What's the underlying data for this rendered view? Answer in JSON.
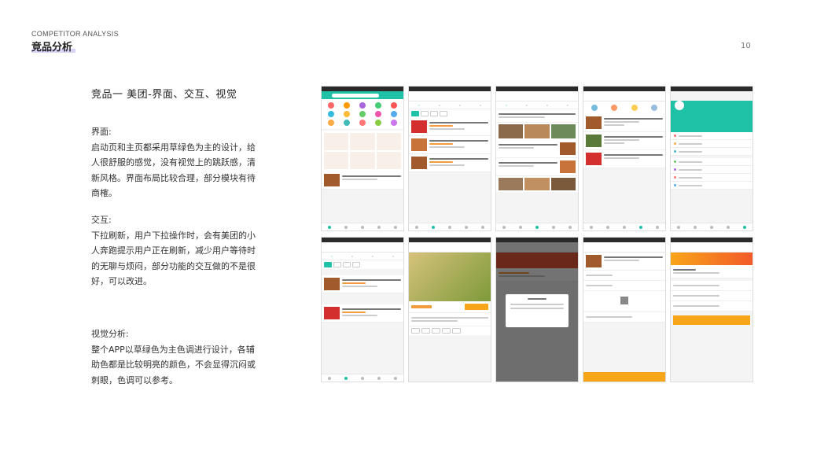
{
  "header": {
    "subtitle": "COMPETITOR ANALYSIS",
    "title": "竞品分析",
    "page_number": "10"
  },
  "section_title": "竞品一  美团-界面、交互、视觉",
  "blocks": [
    {
      "heading": "界面:",
      "body": "启动页和主页都采用草绿色为主的设计，给人很舒服的感觉，没有视觉上的跳跃感，清新风格。界面布局比较合理，部分模块有待商榷。"
    },
    {
      "heading": "交互:",
      "body": "下拉刷新，用户下拉操作时，会有美团的小人奔跑提示用户正在刷新，减少用户等待时的无聊与烦闷，部分功能的交互做的不是很好，可以改进。"
    },
    {
      "heading": "视觉分析:",
      "body": "整个APP以草绿色为主色调进行设计，各辅助色都是比较明亮的颜色，不会显得沉闷或刺眼，色调可以参考。"
    }
  ],
  "colors": {
    "brand_green": "#1fc2a7",
    "accent_orange": "#f8a519"
  }
}
